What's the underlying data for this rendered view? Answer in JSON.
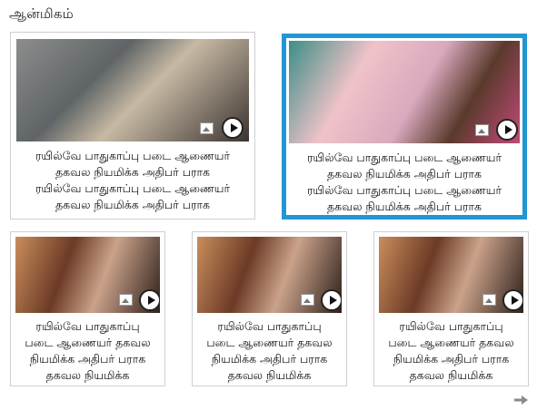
{
  "section": {
    "title": "ஆன்மிகம்"
  },
  "top_cards": [
    {
      "caption": [
        "ரயில்வே பாதுகாப்பு படை ஆணையர்",
        "தகவல நியமிக்க  அதிபர் பராக",
        "ரயில்வே பாதுகாப்பு படை ஆணையர்",
        "தகவல நியமிக்க  அதிபர் பராக"
      ],
      "gallery_icon": "gallery-icon",
      "play_icon": "play-icon",
      "selected": false
    },
    {
      "caption": [
        "ரயில்வே பாதுகாப்பு படை ஆணையர்",
        "தகவல நியமிக்க  அதிபர் பராக",
        "ரயில்வே பாதுகாப்பு படை ஆணையர்",
        "தகவல நியமிக்க  அதிபர் பராக"
      ],
      "gallery_icon": "gallery-icon",
      "play_icon": "play-icon",
      "selected": true
    }
  ],
  "bottom_cards": [
    {
      "caption": [
        "ரயில்வே பாதுகாப்பு",
        "படை ஆணையர் தகவல",
        "நியமிக்க  அதிபர் பராக",
        "தகவல நியமிக்க"
      ]
    },
    {
      "caption": [
        "ரயில்வே பாதுகாப்பு",
        "படை ஆணையர் தகவல",
        "நியமிக்க  அதிபர் பராக",
        "தகவல நியமிக்க"
      ]
    },
    {
      "caption": [
        "ரயில்வே பாதுகாப்பு",
        "படை ஆணையர் தகவல",
        "நியமிக்க  அதிபர் பராக",
        "தகவல நியமிக்க"
      ]
    }
  ],
  "colors": {
    "selected_border": "#2196d3",
    "card_border": "#cfcfcf"
  },
  "nav": {
    "next_icon": "arrow-right-icon"
  }
}
